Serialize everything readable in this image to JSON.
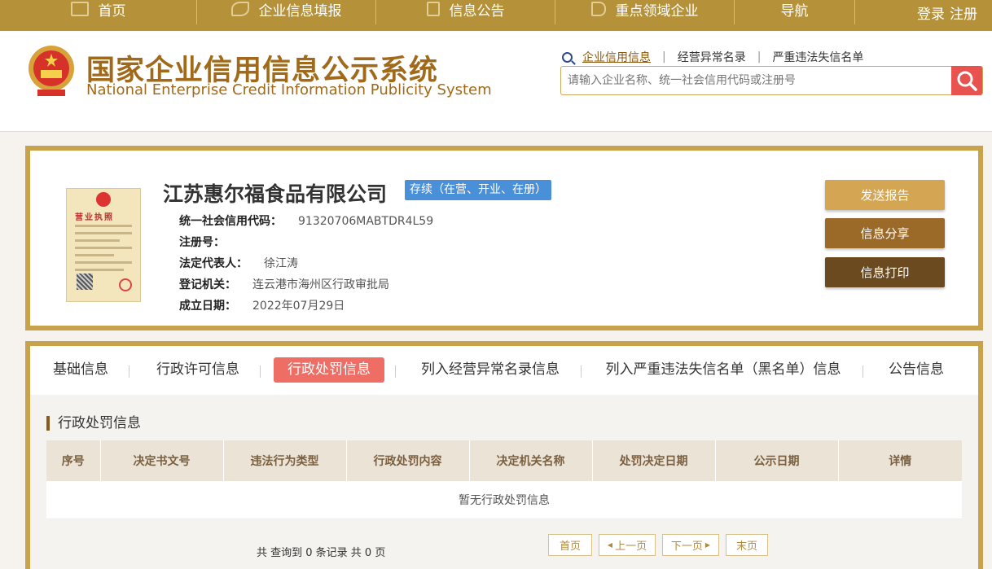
{
  "topnav": {
    "items": [
      {
        "label": "首页",
        "icon": "monitor-icon"
      },
      {
        "label": "企业信息填报",
        "icon": "pen-icon"
      },
      {
        "label": "信息公告",
        "icon": "document-icon"
      },
      {
        "label": "重点领域企业",
        "icon": "speaker-icon"
      },
      {
        "label": "导航"
      }
    ],
    "login": "登录",
    "register": "注册"
  },
  "header": {
    "title_cn": "国家企业信用信息公示系统",
    "title_en": "National Enterprise Credit Information Publicity System",
    "quicklinks": [
      "企业信用信息",
      "经营异常名录",
      "严重违法失信名单"
    ],
    "search_placeholder": "请输入企业名称、统一社会信用代码或注册号"
  },
  "company": {
    "name": "江苏惠尔福食品有限公司",
    "status": "存续（在营、开业、在册）",
    "license_title": "营业执照",
    "fields": [
      {
        "label": "统一社会信用代码：",
        "value": "91320706MABTDR4L59"
      },
      {
        "label": "注册号：",
        "value": ""
      },
      {
        "label": "法定代表人：",
        "value": "徐江涛"
      },
      {
        "label": "登记机关：",
        "value": "连云港市海州区行政审批局"
      },
      {
        "label": "成立日期：",
        "value": "2022年07月29日"
      }
    ],
    "actions": [
      {
        "label": "发送报告",
        "color": "#d4a552"
      },
      {
        "label": "信息分享",
        "color": "#9c6a28"
      },
      {
        "label": "信息打印",
        "color": "#6a4a1e"
      }
    ]
  },
  "tabs": [
    "基础信息",
    "行政许可信息",
    "行政处罚信息",
    "列入经营异常名录信息",
    "列入严重违法失信名单（黑名单）信息",
    "公告信息"
  ],
  "active_tab": "行政处罚信息",
  "section": {
    "title": "行政处罚信息",
    "columns": [
      "序号",
      "决定书文号",
      "违法行为类型",
      "行政处罚内容",
      "决定机关名称",
      "处罚决定日期",
      "公示日期",
      "详情"
    ],
    "empty_text": "暂无行政处罚信息"
  },
  "pager": {
    "info": "共 查询到 0 条记录 共 0 页",
    "first": "首页",
    "prev": "上一页",
    "next": "下一页",
    "last": "末页"
  },
  "colors": {
    "nav_bg": "#b5923a",
    "accent_gold": "#c9a34c",
    "active_tab": "#ee6e66",
    "status_badge": "#4a90d9",
    "search_button": "#e8534f"
  }
}
